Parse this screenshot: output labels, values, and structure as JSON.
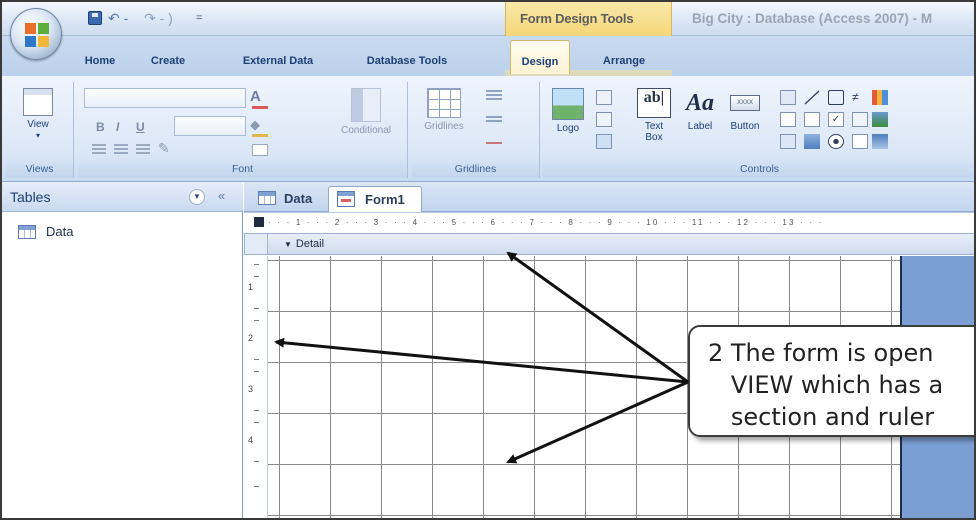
{
  "titlebar": {
    "context_group": "Form Design Tools",
    "window_title": "Big City : Database (Access 2007) - M",
    "qat_undo": "↶ -",
    "qat_redo": "↷ - ) ",
    "qat_customize": "="
  },
  "tabs": [
    "Home",
    "Create",
    "External Data",
    "Database Tools",
    "Design",
    "Arrange"
  ],
  "ribbon": {
    "views": {
      "view_label": "View",
      "group_label": "Views"
    },
    "font": {
      "bold": "B",
      "italic": "I",
      "underline": "U",
      "conditional": "Conditional",
      "group_label": "Font"
    },
    "gridlines": {
      "gridlines_label": "Gridlines",
      "group_label": "Gridlines"
    },
    "controls": {
      "logo": "Logo",
      "textbox_icon": "ab|",
      "textbox": "Text Box",
      "label_icon": "Aa",
      "label": "Label",
      "button_icon": "XXXX",
      "button": "Button",
      "group_label": "Controls"
    }
  },
  "nav": {
    "title": "Tables",
    "items": [
      "Data"
    ]
  },
  "doc_tabs": [
    "Data",
    "Form1"
  ],
  "form": {
    "section": "Detail",
    "h_ruler": "· · · 1 · · · 2 · · · 3 · · · 4 · · · 5 · · · 6 · · · 7 · · · 8 · · · 9 · · · 10 · · · 11 · · · 12 · · · 13 · · ·",
    "v_ruler": [
      "1",
      "2",
      "3",
      "4"
    ]
  },
  "callout": {
    "text": "2 The form is open\n   VIEW which has a\n   section and ruler"
  },
  "colors": {
    "ribbon": "#dce8f7",
    "context_tab": "#f5d77a",
    "form_edge": "#7b9fd3",
    "grid": "#8a8a8a"
  },
  "icons": [
    "office-button-icon",
    "save-icon",
    "undo-icon",
    "redo-icon",
    "view-icon",
    "font-color-icon",
    "fill-color-icon",
    "line-color-icon",
    "format-painter-icon",
    "conditional-icon",
    "gridlines-icon",
    "logo-icon",
    "textbox-icon",
    "label-icon",
    "button-icon",
    "table-icon",
    "form-icon",
    "chevron-down-icon",
    "collapse-icon"
  ]
}
